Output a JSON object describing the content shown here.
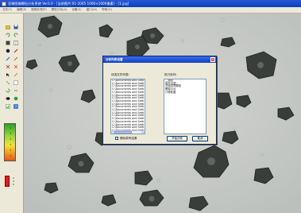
{
  "window": {
    "title": "显微图像颗粒分析系统 Ver3.0 - [当前图片:01-2005 1000×1000像素] - [1.jpg]"
  },
  "menubar": {
    "items": [
      "文件(F)",
      "编辑(E)",
      "图像处理(P)",
      "颗粒分析(A)",
      "设置(S)",
      "窗口(W)",
      "帮助(H)"
    ]
  },
  "toolbar": {
    "colorbar_labels": [
      "6",
      "8",
      "4",
      "0",
      "5",
      "5"
    ],
    "red_labels": [
      "2",
      "4",
      "6"
    ]
  },
  "dialog": {
    "title": "分析列表设置",
    "close_label": "×",
    "left_heading": "待选文件列表:",
    "right_heading": "执行序列:",
    "file_list": [
      "C:\\Documents and Setti",
      "C:\\Documents and Setti",
      "C:\\Documents and Setti",
      "C:\\Documents and Setti",
      "C:\\Documents and Setti",
      "C:\\Documents and Setti",
      "C:\\Documents and Setti",
      "C:\\Documents and Setti",
      "C:\\Documents and Setti",
      "C:\\Documents and Setti",
      "C:\\Documents and Setti",
      "C:\\Documents and Setti",
      "C:\\Documents and Setti",
      "C:\\Documents and Setti",
      "C:\\Documents and Setti",
      "C:\\Documents and Setti",
      "C:\\Documents and Setti",
      "C:\\Documents and Setti"
    ],
    "sequence_list": [
      "二值化",
      "填充空洞",
      "去除边界颗粒",
      "删除小点",
      "计算粒度"
    ],
    "checkbox_label": "删除原有结果",
    "checkbox_checked": true,
    "start_button": "开始分析",
    "cancel_button": "取消"
  }
}
